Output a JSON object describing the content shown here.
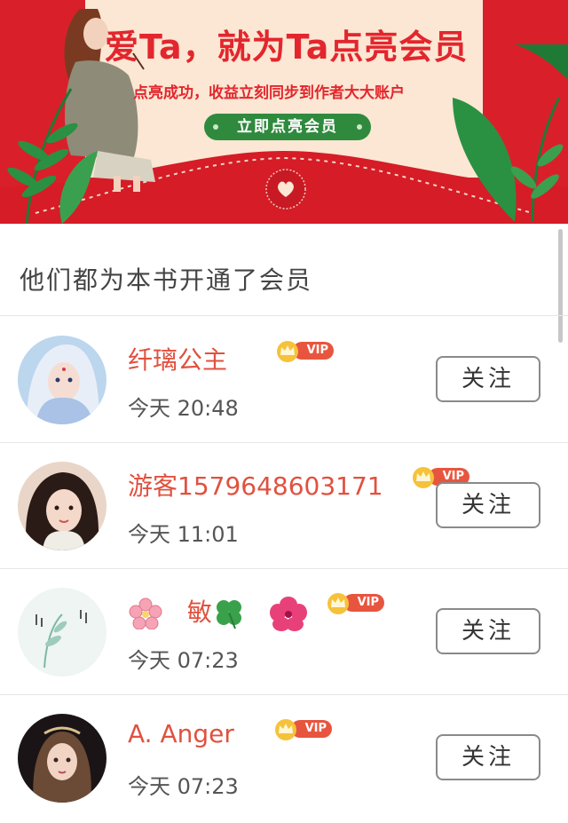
{
  "banner": {
    "title": "爱Ta，就为Ta点亮会员",
    "subtitle": "点亮成功，收益立刻同步到作者大大账户",
    "cta_label": "立即点亮会员",
    "colors": {
      "background": "#d9202a",
      "card": "#fbe7d3",
      "title": "#e3262e",
      "cta": "#2f8a3e"
    }
  },
  "section": {
    "title": "他们都为本书开通了会员"
  },
  "members": [
    {
      "name": "纤璃公主",
      "vip_label": "VIP",
      "time": "今天 20:48",
      "follow_label": "关注",
      "avatar": "anime-princess-avatar"
    },
    {
      "name": "游客1579648603171",
      "vip_label": "VIP",
      "time": "今天 11:01",
      "follow_label": "关注",
      "avatar": "girl-photo-avatar"
    },
    {
      "name_parts": [
        "敏"
      ],
      "name_emojis": [
        "cherry-blossom",
        "four-leaf-clover",
        "hibiscus"
      ],
      "vip_label": "VIP",
      "time": "今天 07:23",
      "follow_label": "关注",
      "avatar": "watercolor-avatar"
    },
    {
      "name": "A. Anger",
      "vip_label": "VIP",
      "time": "今天 07:23",
      "follow_label": "关注",
      "avatar": "doll-avatar"
    }
  ],
  "theme": {
    "name_color": "#e0513f",
    "vip_color": "#e8553f",
    "crown_color": "#f5c23a"
  }
}
